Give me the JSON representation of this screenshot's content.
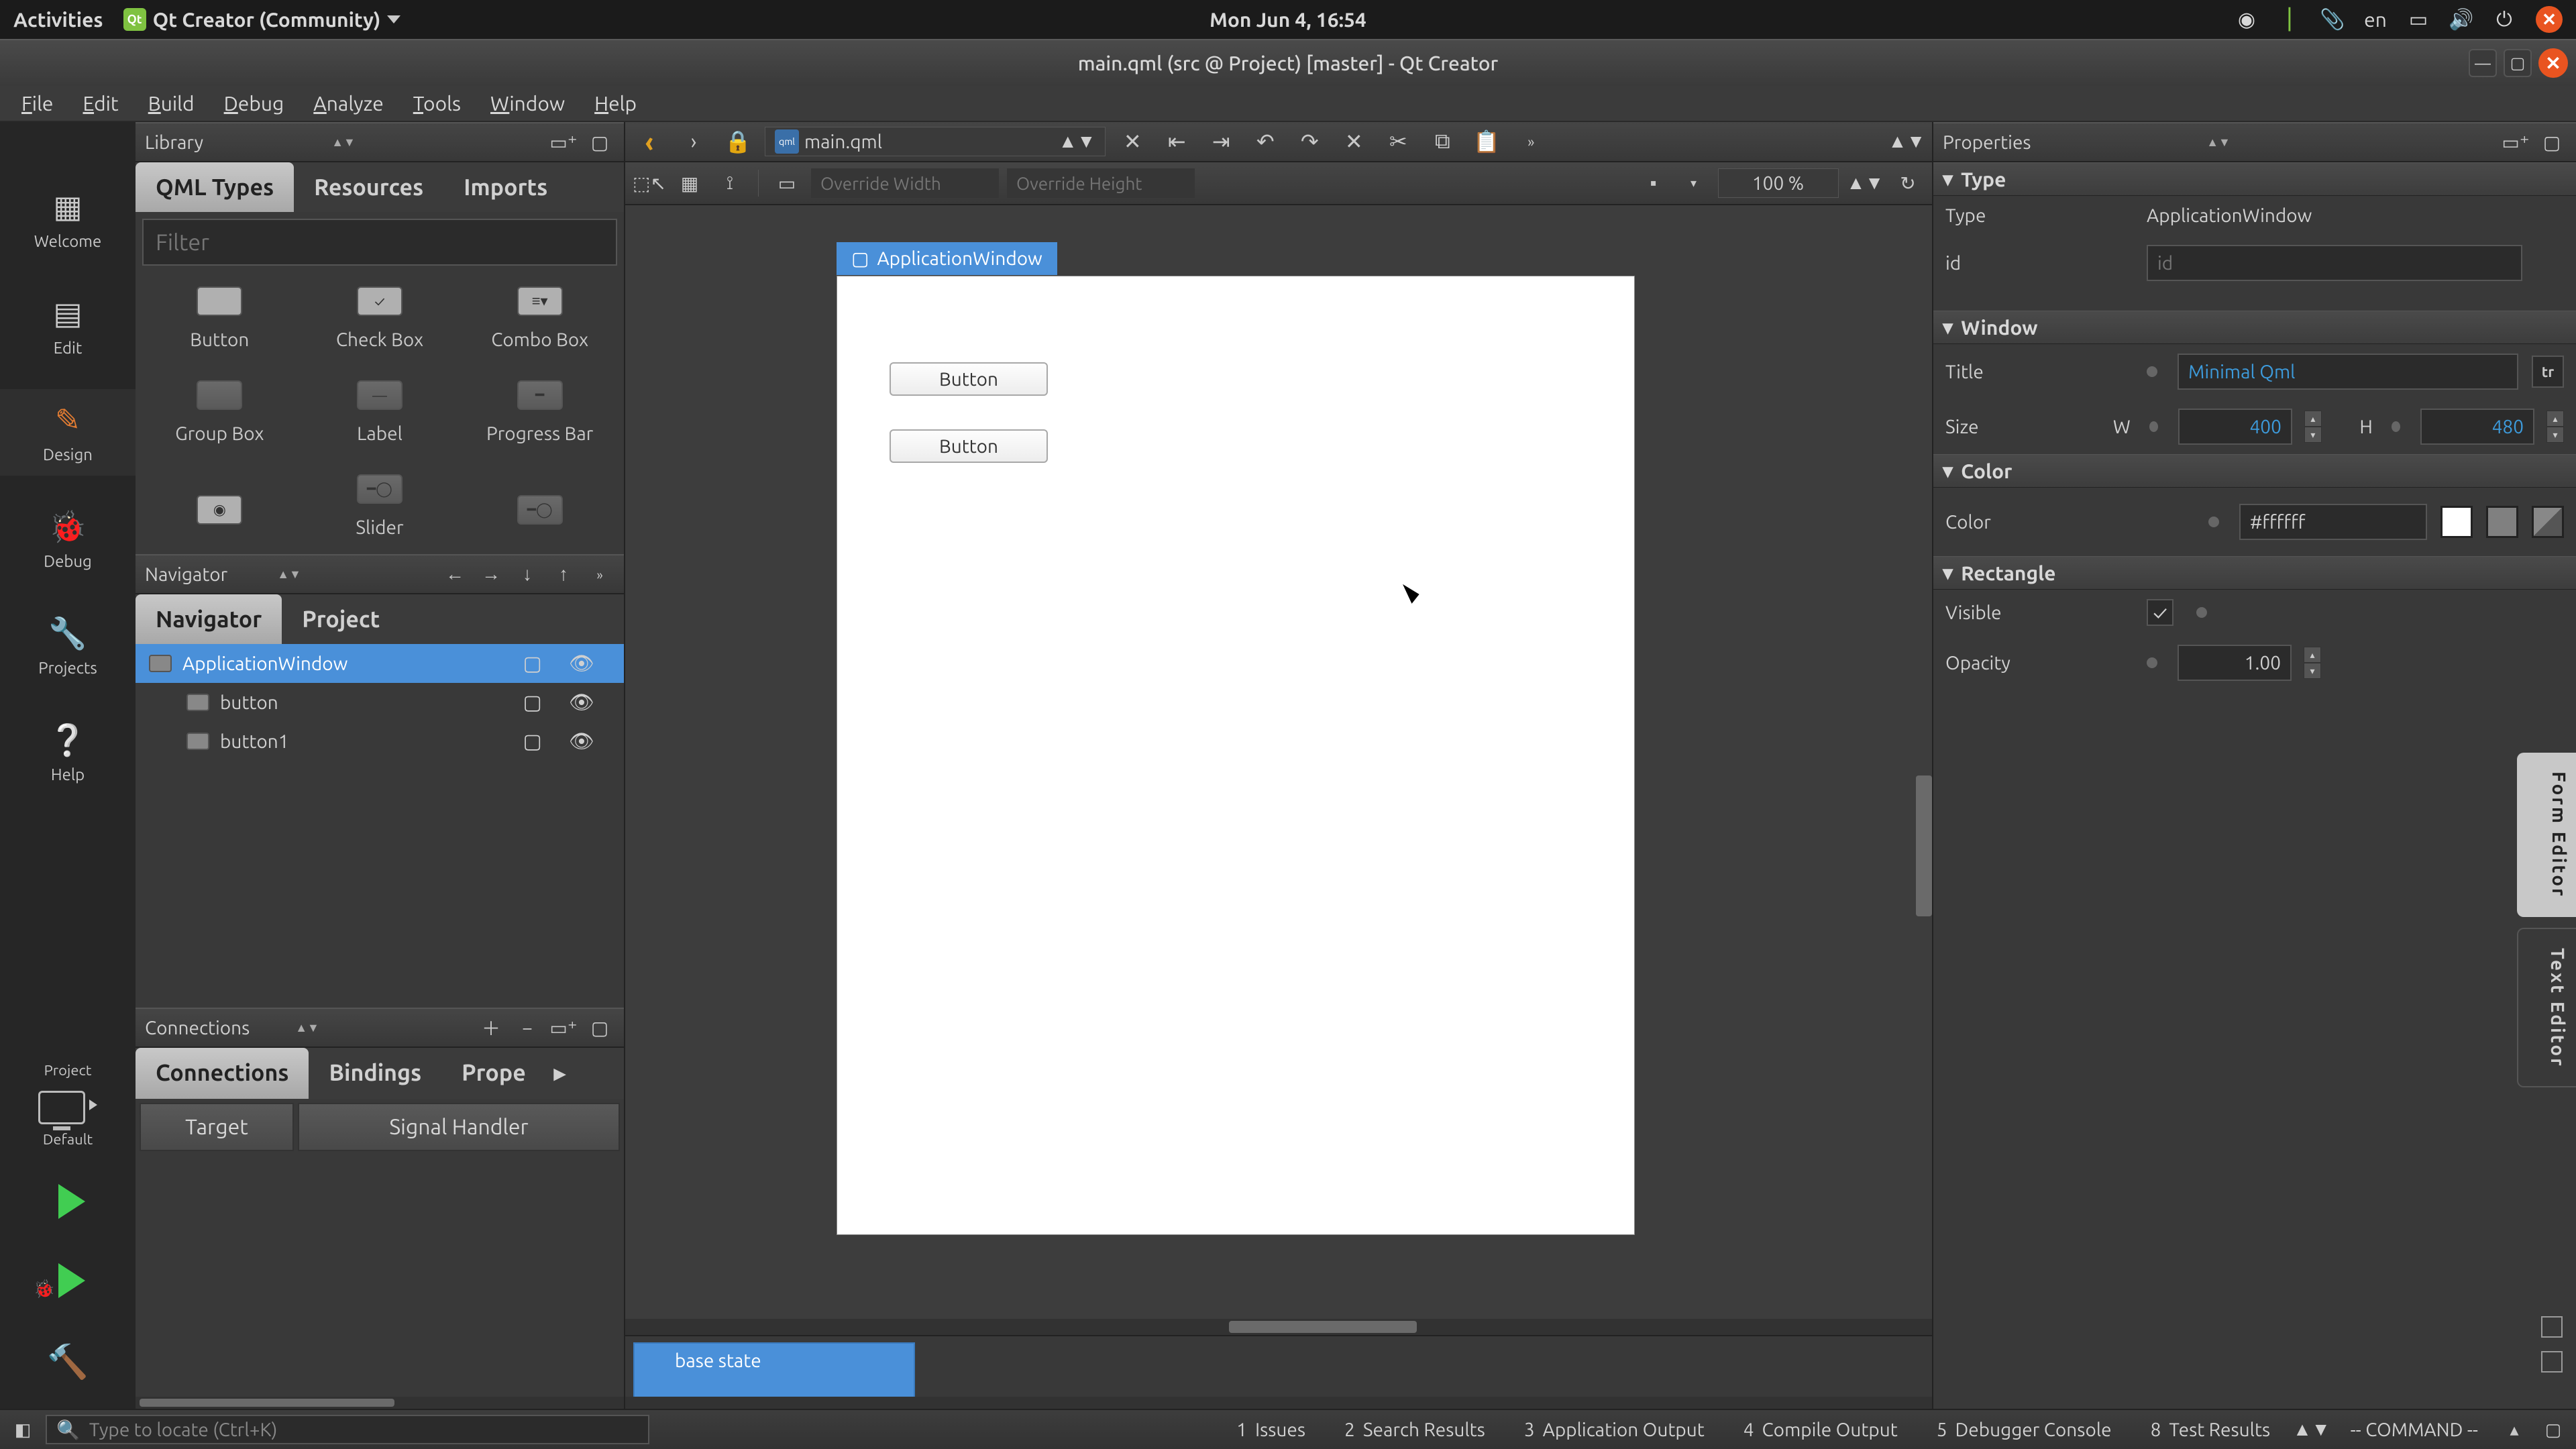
{
  "gnome": {
    "activities": "Activities",
    "app_name": "Qt Creator (Community)",
    "clock": "Mon Jun  4, 16:54",
    "lang": "en"
  },
  "window": {
    "title": "main.qml (src @ Project) [master] - Qt Creator"
  },
  "menubar": [
    "File",
    "Edit",
    "Build",
    "Debug",
    "Analyze",
    "Tools",
    "Window",
    "Help"
  ],
  "modes": {
    "welcome": "Welcome",
    "edit": "Edit",
    "design": "Design",
    "debug": "Debug",
    "projects": "Projects",
    "help": "Help",
    "project_label": "Project",
    "kit_label": "Default"
  },
  "library": {
    "title": "Library",
    "tabs": {
      "types": "QML Types",
      "resources": "Resources",
      "imports": "Imports"
    },
    "filter_placeholder": "Filter",
    "items": [
      "Button",
      "Check Box",
      "Combo Box",
      "Group Box",
      "Label",
      "Progress Bar",
      "",
      "Slider",
      ""
    ]
  },
  "navigator": {
    "title": "Navigator",
    "tabs": {
      "navigator": "Navigator",
      "project": "Project"
    },
    "rows": [
      {
        "name": "ApplicationWindow",
        "indent": 0,
        "selected": true
      },
      {
        "name": "button",
        "indent": 1,
        "selected": false
      },
      {
        "name": "button1",
        "indent": 1,
        "selected": false
      }
    ]
  },
  "connections": {
    "title": "Connections",
    "tabs": {
      "connections": "Connections",
      "bindings": "Bindings",
      "properties": "Prope"
    },
    "cols": {
      "target": "Target",
      "handler": "Signal Handler"
    }
  },
  "document": {
    "open_file": "main.qml"
  },
  "designer": {
    "override_w": "Override Width",
    "override_h": "Override Height",
    "zoom": "100 %",
    "artboard_label": "ApplicationWindow",
    "buttons": [
      "Button",
      "Button"
    ],
    "state": "base state"
  },
  "properties": {
    "title": "Properties",
    "sections": {
      "type": "Type",
      "window": "Window",
      "color": "Color",
      "rectangle": "Rectangle"
    },
    "type": {
      "label": "Type",
      "value": "ApplicationWindow",
      "id_label": "id",
      "id_placeholder": "id"
    },
    "window": {
      "title_label": "Title",
      "title_value": "Minimal Qml",
      "size_label": "Size",
      "w_label": "W",
      "w_value": "400",
      "h_label": "H",
      "h_value": "480"
    },
    "color": {
      "label": "Color",
      "value": "#ffffff"
    },
    "rectangle": {
      "visible_label": "Visible",
      "visible_checked": "✓",
      "opacity_label": "Opacity",
      "opacity_value": "1.00"
    },
    "side_tabs": {
      "form": "Form Editor",
      "text": "Text Editor"
    }
  },
  "status": {
    "locator_placeholder": "Type to locate (Ctrl+K)",
    "panes": [
      {
        "n": "1",
        "label": "Issues"
      },
      {
        "n": "2",
        "label": "Search Results"
      },
      {
        "n": "3",
        "label": "Application Output"
      },
      {
        "n": "4",
        "label": "Compile Output"
      },
      {
        "n": "5",
        "label": "Debugger Console"
      },
      {
        "n": "8",
        "label": "Test Results"
      }
    ],
    "command": "-- COMMAND --"
  }
}
